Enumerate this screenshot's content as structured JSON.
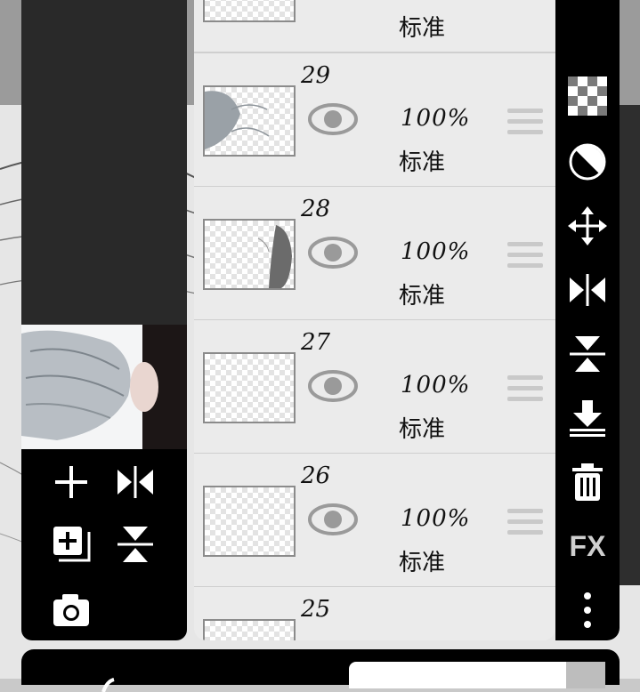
{
  "left_panel": {
    "tools": [
      {
        "name": "add-layer",
        "icon": "plus-icon"
      },
      {
        "name": "flip-horizontal",
        "icon": "flip-horizontal-icon"
      },
      {
        "name": "duplicate-layer",
        "icon": "add-copy-icon"
      },
      {
        "name": "flip-vertical",
        "icon": "flip-vertical-icon"
      },
      {
        "name": "camera",
        "icon": "camera-icon"
      }
    ]
  },
  "layers": [
    {
      "number": "",
      "opacity": "",
      "blend": "标准"
    },
    {
      "number": "29",
      "opacity": "100%",
      "blend": "标准"
    },
    {
      "number": "28",
      "opacity": "100%",
      "blend": "标准"
    },
    {
      "number": "27",
      "opacity": "100%",
      "blend": "标准"
    },
    {
      "number": "26",
      "opacity": "100%",
      "blend": "标准"
    },
    {
      "number": "25",
      "opacity": "",
      "blend": ""
    }
  ],
  "right_toolbar": {
    "fx_label": "FX",
    "icons": [
      "checker-icon",
      "clipping-icon",
      "move-icon",
      "flip-horizontal-icon",
      "flip-vertical-icon",
      "merge-down-icon",
      "trash-icon",
      "fx-icon",
      "more-icon"
    ]
  },
  "colors": {
    "panel": "#000000",
    "list_bg": "#ececec",
    "eye": "#9a9a9a"
  }
}
